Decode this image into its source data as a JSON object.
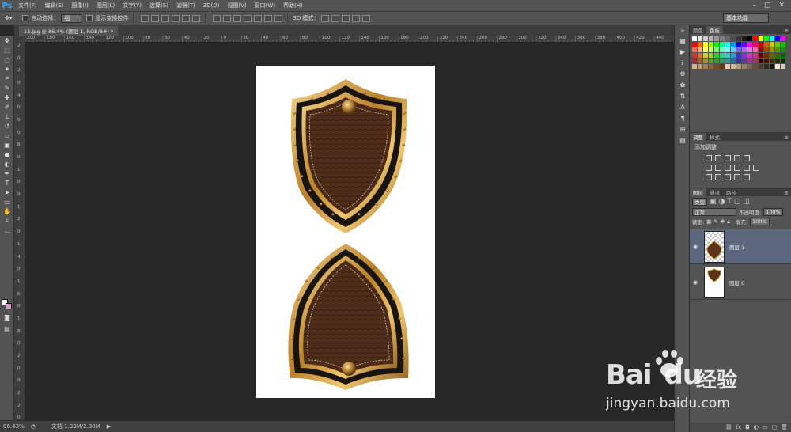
{
  "app": {
    "logo": "Ps"
  },
  "menu": [
    "文件(F)",
    "编辑(E)",
    "图像(I)",
    "图层(L)",
    "文字(Y)",
    "选择(S)",
    "滤镜(T)",
    "3D(D)",
    "视图(V)",
    "窗口(W)",
    "帮助(H)"
  ],
  "options": {
    "auto_select_label": "自动选择：",
    "auto_select_value": "组",
    "show_transform_label": "显示变换控件",
    "mode_3d_label": "3D 模式：",
    "workspace": "基本功能"
  },
  "document": {
    "tab_title": "13.jpg @ 86.4% (图层 1, RGB/8#) *"
  },
  "ruler": {
    "top_labels": [
      "200",
      "180",
      "160",
      "140",
      "120",
      "100",
      "80",
      "60",
      "40",
      "20",
      "0",
      "20",
      "40",
      "60",
      "80",
      "100",
      "120",
      "140",
      "160",
      "180",
      "200",
      "220",
      "240",
      "260",
      "280",
      "300",
      "320",
      "340",
      "360",
      "380",
      "400",
      "420",
      "440"
    ],
    "left_labels": [
      "2",
      "0",
      "2",
      "0",
      "4",
      "0",
      "6",
      "0",
      "8",
      "0",
      "1",
      "0",
      "0",
      "1",
      "2",
      "0",
      "1",
      "4",
      "0",
      "1",
      "6",
      "0",
      "1",
      "8",
      "0",
      "2",
      "0",
      "0",
      "2",
      "2",
      "0"
    ]
  },
  "status": {
    "zoom": "86.43%",
    "doc_info": "文档:1.33M/2.38M"
  },
  "panels": {
    "swatch_tabs": [
      "颜色",
      "色板"
    ],
    "adjust_tabs": [
      "调整",
      "样式"
    ],
    "adjust_title": "添加调整",
    "layers_tabs": [
      "图层",
      "通道",
      "路径"
    ],
    "filter_kind": "类型",
    "blend_mode": "正常",
    "opacity_label": "不透明度:",
    "opacity_value": "100%",
    "lock_label": "锁定:",
    "fill_label": "填充:",
    "fill_value": "100%",
    "layers": [
      {
        "name": "图层 1"
      },
      {
        "name": "图层 0"
      }
    ]
  },
  "watermark": {
    "brand": "Bai",
    "brand2": "du",
    "cn": "经验",
    "url": "jingyan.baidu.com"
  },
  "colors": {
    "ui_bg": "#535353",
    "canvas_bg": "#282828",
    "leather": "#4a2a18",
    "gold": "#c9962f"
  }
}
